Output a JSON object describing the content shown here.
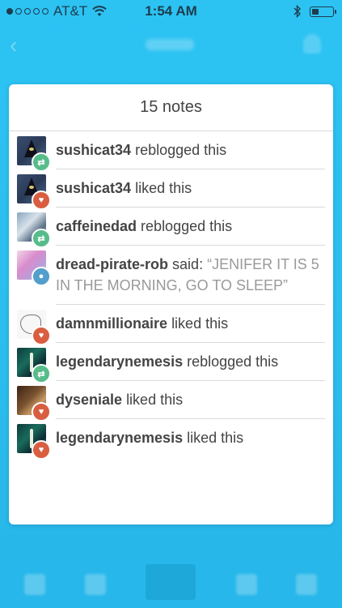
{
  "status_bar": {
    "carrier": "AT&T",
    "time": "1:54 AM",
    "signal_filled": 1,
    "signal_total": 5,
    "battery_level": 0.35
  },
  "notes": {
    "title": "15 notes",
    "items": [
      {
        "user": "sushicat34",
        "action": "reblogged this",
        "type": "reblog",
        "avatar": "sushicat"
      },
      {
        "user": "sushicat34",
        "action": "liked this",
        "type": "like",
        "avatar": "sushicat"
      },
      {
        "user": "caffeinedad",
        "action": "reblogged this",
        "type": "reblog",
        "avatar": "caffeine"
      },
      {
        "user": "dread-pirate-rob",
        "action": "said:",
        "quote": "“JENIFER IT IS 5 IN THE MORNING, GO TO SLEEP”",
        "type": "reply",
        "avatar": "dread"
      },
      {
        "user": "damnmillionaire",
        "action": "liked this",
        "type": "like",
        "avatar": "damn"
      },
      {
        "user": "legendarynemesis",
        "action": "reblogged this",
        "type": "reblog",
        "avatar": "legend"
      },
      {
        "user": "dyseniale",
        "action": "liked this",
        "type": "like",
        "avatar": "dyseniale"
      },
      {
        "user": "legendarynemesis",
        "action": "liked this",
        "type": "like",
        "avatar": "legend"
      }
    ]
  },
  "colors": {
    "background": "#29c1f2",
    "reblog_badge": "#56bc8a",
    "like_badge": "#d95e40",
    "reply_badge": "#529ecc"
  }
}
